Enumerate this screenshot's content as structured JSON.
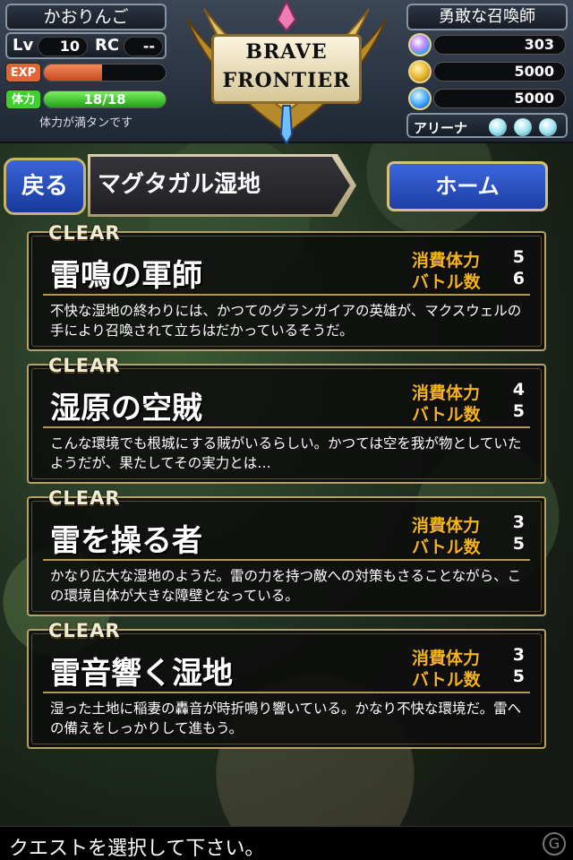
{
  "player": {
    "name": "かおりんご",
    "lv_label": "Lv",
    "lv": "10",
    "rc_label": "RC",
    "rc": "--",
    "exp_label": "EXP",
    "exp_fill": 0.48,
    "stamina_label": "体力",
    "stamina_value": "18/18",
    "stamina_fill": 1.0,
    "stamina_message": "体力が満タンです"
  },
  "logo": {
    "line1": "BRAVE",
    "line2": "FRONTIER"
  },
  "summoner": {
    "title": "勇敢な召喚師",
    "gems": "303",
    "zel": "5000",
    "karma": "5000",
    "arena_label": "アリーナ",
    "arena_orbs": 3
  },
  "colors": {
    "exp_bar": "#e0663a",
    "stamina_bar": "#3fd02f",
    "gold_border": "#b9a066",
    "stat_label": "#f5b31c",
    "button_blue": "#2a52c8"
  },
  "nav": {
    "back_label": "戻る",
    "location": "マグタガル湿地",
    "home_label": "ホーム"
  },
  "quests": [
    {
      "status": "CLEAR",
      "title": "雷鳴の軍師",
      "cost_label": "消費体力",
      "cost": "5",
      "battles_label": "バトル数",
      "battles": "6",
      "description": "不快な湿地の終わりには、かつてのグランガイアの英雄が、マクスウェルの手により召喚されて立ちはだかっているそうだ。"
    },
    {
      "status": "CLEAR",
      "title": "湿原の空賊",
      "cost_label": "消費体力",
      "cost": "4",
      "battles_label": "バトル数",
      "battles": "5",
      "description": "こんな環境でも根城にする賊がいるらしい。かつては空を我が物としていたようだが、果たしてその実力とは…"
    },
    {
      "status": "CLEAR",
      "title": "雷を操る者",
      "cost_label": "消費体力",
      "cost": "3",
      "battles_label": "バトル数",
      "battles": "5",
      "description": "かなり広大な湿地のようだ。雷の力を持つ敵への対策もさることながら、この環境自体が大きな障壁となっている。"
    },
    {
      "status": "CLEAR",
      "title": "雷音響く湿地",
      "cost_label": "消費体力",
      "cost": "3",
      "battles_label": "バトル数",
      "battles": "5",
      "description": "湿った土地に稲妻の轟音が時折鳴り響いている。かなり不快な環境だ。雷への備えをしっかりして進もう。"
    }
  ],
  "footer": {
    "message": "クエストを選択して下さい。"
  }
}
